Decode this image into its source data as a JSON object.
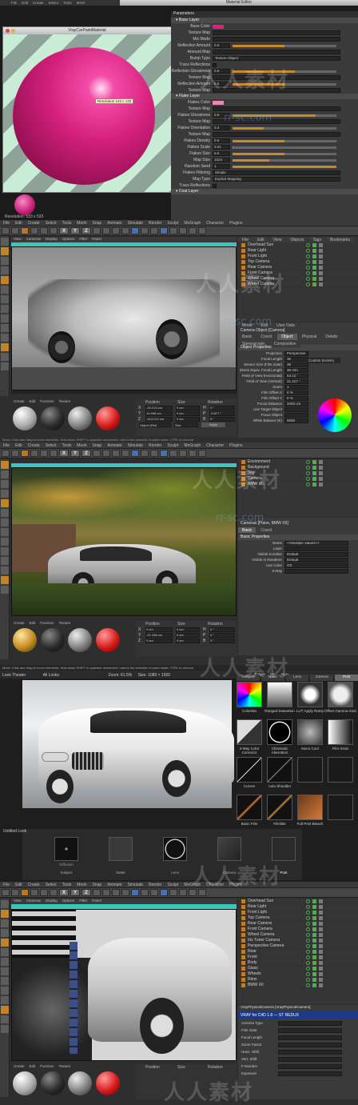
{
  "panel1": {
    "top_menu": [
      "File",
      "Edit",
      "Create",
      "Select",
      "Tools",
      "Mesh",
      "Snap",
      "Animate"
    ],
    "editor_title": "Material Editor",
    "preview_title": "VrayCarPaintMaterial",
    "preview_tooltip": "Resolution 133 x 133",
    "preview_menu": [
      "View",
      "Cameras",
      "Display",
      "Options",
      "Filter",
      "Panel"
    ],
    "resolution_label": "Resolution: 533 x 533",
    "params_header": "Parameters",
    "base_layer_header": "Base Layer",
    "base_params": [
      {
        "label": "Base Color",
        "kind": "color",
        "value": ""
      },
      {
        "label": "Texture Map",
        "kind": "field",
        "value": ""
      },
      {
        "label": "Mix Mode",
        "kind": "field",
        "value": ""
      },
      {
        "label": "Reflection Amount",
        "kind": "num",
        "value": "0.5"
      },
      {
        "label": "Amount Map",
        "kind": "field",
        "value": ""
      },
      {
        "label": "Bump Type",
        "kind": "drop",
        "value": "Texture Object"
      },
      {
        "label": "Trace Reflections",
        "kind": "check",
        "value": ""
      },
      {
        "label": "Reflection Glossiness",
        "kind": "num",
        "value": "0.6"
      },
      {
        "label": "Texture Map",
        "kind": "field",
        "value": ""
      },
      {
        "label": "Reflection Amount",
        "kind": "num",
        "value": "0.5"
      },
      {
        "label": "Texture Map",
        "kind": "field",
        "value": ""
      }
    ],
    "flake_layer_header": "Flake Layer",
    "flake_params": [
      {
        "label": "Flakes Color",
        "kind": "color",
        "value": ""
      },
      {
        "label": "Texture Map",
        "kind": "field",
        "value": ""
      },
      {
        "label": "Flakes Glossiness",
        "kind": "num",
        "value": "0.8"
      },
      {
        "label": "Texture Map",
        "kind": "field",
        "value": ""
      },
      {
        "label": "Flakes Orientation",
        "kind": "num",
        "value": "0.3"
      },
      {
        "label": "Texture Map",
        "kind": "field",
        "value": ""
      },
      {
        "label": "Flakes Density",
        "kind": "num",
        "value": "0.5"
      },
      {
        "label": "Flakes Scale",
        "kind": "num",
        "value": "0.01"
      },
      {
        "label": "Flakes Size",
        "kind": "num",
        "value": "0.5"
      },
      {
        "label": "Map Size",
        "kind": "num",
        "value": "1024"
      },
      {
        "label": "Random Seed",
        "kind": "num",
        "value": "1"
      },
      {
        "label": "Flakes Filtering",
        "kind": "drop",
        "value": "Simple"
      },
      {
        "label": "Map Type",
        "kind": "drop",
        "value": "Explicit Mapping"
      },
      {
        "label": "Trace Reflections",
        "kind": "check",
        "value": ""
      }
    ],
    "coat_layer_header": "Coat Layer",
    "colors": {
      "base": "#e0207a",
      "flakes": "#e888b8",
      "sphere": "#d8227e",
      "stripe": "#b8e8c8"
    }
  },
  "panel2": {
    "menu": [
      "File",
      "Edit",
      "Create",
      "Select",
      "Tools",
      "Mesh",
      "Snap",
      "Animate",
      "Simulate",
      "Render",
      "Sculpt",
      "MoGraph",
      "Character",
      "Plugins",
      "Script",
      "Window",
      "Help"
    ],
    "tags": [
      "C4D Plugins",
      "VRAY Photo & White",
      "Script",
      "Window",
      "Layout",
      "Startup"
    ],
    "viewport_menu": [
      "View",
      "Cameras",
      "Display",
      "Options",
      "Filter",
      "Panel"
    ],
    "objects_tabs": [
      "File",
      "Edit",
      "View",
      "Objects",
      "Tags",
      "Bookmarks"
    ],
    "objects": [
      "Overhead Sun",
      "Rear Light",
      "Front Light",
      "Top Camera",
      "Rear Camera",
      "Front Camera",
      "Wheel Camera",
      "Wheel Camera"
    ],
    "attr_tabs": [
      "Mode",
      "Edit",
      "User Data"
    ],
    "attr_title": "Camera Object [Camera]",
    "attr_subtabs": [
      "Basic",
      "Coord.",
      "Object",
      "Physical",
      "Details",
      "Stereoscopic",
      "Composition"
    ],
    "object_props_header": "Object Properties",
    "object_props": [
      {
        "label": "Projection",
        "value": "Perspective"
      },
      {
        "label": "Focal Length",
        "value": "36"
      },
      {
        "label": "Sensor Size (Film Gate)",
        "value": "36"
      },
      {
        "label": "35mm Equiv. Focal Length",
        "value": "36 mm"
      },
      {
        "label": "Field of View (Horizontal)",
        "value": "53.13 °"
      },
      {
        "label": "Field of View (Vertical)",
        "value": "31.417 °"
      },
      {
        "label": "Zoom",
        "value": "1"
      },
      {
        "label": "Film Offset X",
        "value": "0 %"
      },
      {
        "label": "Film Offset Y",
        "value": "0 %"
      },
      {
        "label": "Focus Distance",
        "value": "2000 cm"
      },
      {
        "label": "Use Target Object",
        "value": ""
      },
      {
        "label": "Focus Object",
        "value": ""
      },
      {
        "label": "White Balance (K)",
        "value": "6500"
      }
    ],
    "custom_dropdown": "Custom (Kelvin)",
    "mat_menu": [
      "Create",
      "Edit",
      "Function",
      "Texture"
    ],
    "coord_headers": [
      "Position",
      "Size",
      "Rotation"
    ],
    "coord_rows": [
      {
        "axis": "X",
        "pos": "-23.213 cm",
        "size": "0 cm",
        "rot": "H",
        "rotv": "0 °"
      },
      {
        "axis": "Y",
        "pos": "14.998 cm",
        "size": "0 cm",
        "rot": "P",
        "rotv": "-5.877 °"
      },
      {
        "axis": "Z",
        "pos": "-413.212 cm",
        "size": "0 cm",
        "rot": "B",
        "rotv": "0 °"
      }
    ],
    "coord_buttons": [
      "Object (Rel)",
      "Size",
      "Apply"
    ]
  },
  "panel3": {
    "status_top": "Move: Click and drag to move elements. Hold down SHIFT to quantize movement / add to the selection in point mode, CTRL to remove.",
    "objects": [
      "Environment",
      "Background",
      "Sky",
      "Camera",
      "BMW X6"
    ],
    "attr_title": "Cameras [Plane, BMW X6]",
    "attr_subtabs": [
      "Basic",
      "Coord."
    ],
    "basic_header": "Basic Properties",
    "basic_props": [
      {
        "label": "Name",
        "value": "<<Multiple Values>>"
      },
      {
        "label": "Layer",
        "value": ""
      },
      {
        "label": "Visible in Editor",
        "value": "Default"
      },
      {
        "label": "Visible in Renderer",
        "value": "Default"
      },
      {
        "label": "Use Color",
        "value": "Off"
      },
      {
        "label": "X-Ray",
        "value": ""
      }
    ],
    "coord_rows": [
      {
        "axis": "X",
        "pos": "0 cm",
        "size": "0 cm",
        "rot": "H",
        "rotv": "0 °"
      },
      {
        "axis": "Y",
        "pos": "-21.196 cm",
        "size": "0 cm",
        "rot": "P",
        "rotv": "0 °"
      },
      {
        "axis": "Z",
        "pos": "0 cm",
        "size": "0 cm",
        "rot": "B",
        "rotv": "0 °"
      }
    ],
    "status_bottom": "Move: Click and drag to move elements. Hold down SHIFT to quantize movement / add to the selection in point mode, CTRL to remove."
  },
  "panel4": {
    "title": "Look Theater",
    "presets": "All Looks",
    "zoom": "Zoom: 61.5%",
    "res": "Size: 1080 × 1920",
    "graph_tabs": [
      "Graph",
      "Info",
      "Help"
    ],
    "fx_tabs": [
      "Subject",
      "Matte",
      "Lens",
      "Camera",
      "Post"
    ],
    "fx_items": [
      "Colorista",
      "Ranged Saturation",
      "LUT Apply Ramp",
      "Offset Gamma Gain",
      "3-Way Color Corrector",
      "Chromatic Aberration",
      "Mono Cool",
      "Film Grain",
      "Curves",
      "Auto Shoulder",
      "",
      "",
      "Basic Film",
      "Filmlike",
      "Full Print Bleach",
      ""
    ],
    "look_title": "Untitled Look",
    "look_nodes": [
      "Subject",
      "Matte",
      "Lens",
      "Camera",
      "Post"
    ],
    "look_node_sub": [
      "Diffusion",
      "",
      "",
      "",
      ""
    ]
  },
  "panel5": {
    "objects": [
      "Overhead Sun",
      "Rear Light",
      "Front Light",
      "Top Camera",
      "Rear Camera",
      "Front Camera",
      "Wheel Camera",
      "Iris Tuner Camera",
      "Perspective Camera",
      "Rear",
      "Front",
      "Body",
      "Glass",
      "Wheels",
      "Rims",
      "BMW X6"
    ],
    "attr_title": "VrayPhysicalCamera [VrayPhysicalCamera]",
    "vray_label": "VRAY for C4D 1.8 — ST REDUX",
    "vray_props": [
      "Camera Type",
      "Film Gate",
      "Focal Length",
      "Zoom Factor",
      "Horiz. Shift",
      "Vert. Shift",
      "F-Number",
      "Exposure"
    ],
    "mat_menu": [
      "Create",
      "Edit",
      "Function",
      "Texture"
    ]
  },
  "watermark": {
    "cn_text": "人人素材",
    "site": "rr-sc.com"
  }
}
